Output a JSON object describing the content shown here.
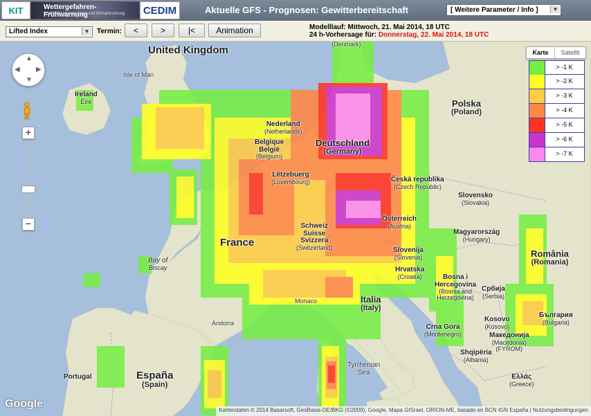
{
  "header": {
    "kit_logo": "KIT",
    "warn_logo_title": "Wettergefahren-Frühwarnung",
    "warn_logo_sub": "Institut für Meteorologie und Klimaforschung",
    "cedim_logo": "CEDIM",
    "title": "Aktuelle GFS - Prognosen: Gewitterbereitschaft",
    "param_select": "[ Weitere Parameter / Info ]"
  },
  "toolbar": {
    "parameter_select": "Lifted Index",
    "termin_label": "Termin:",
    "prev_button": "<",
    "next_button": ">",
    "first_button": "|<",
    "animation_button": "Animation",
    "run_line": "Modelllauf: Mittwoch, 21. Mai 2014, 18 UTC",
    "forecast_prefix": "24 h-Vorhersage für: ",
    "forecast_date": "Donnerstag, 22. Mai 2014, 18 UTC"
  },
  "map_type": {
    "karte": "Karte",
    "satellit": "Satellit"
  },
  "legend": [
    {
      "label": "> -1 K",
      "color": "#77ee44"
    },
    {
      "label": "> -2 K",
      "color": "#ffff22"
    },
    {
      "label": "> -3 K",
      "color": "#ffcc44"
    },
    {
      "label": "> -4 K",
      "color": "#ff8844"
    },
    {
      "label": "> -5 K",
      "color": "#ff3322"
    },
    {
      "label": "> -6 K",
      "color": "#cc33cc"
    },
    {
      "label": "> -7 K",
      "color": "#ff88ee"
    }
  ],
  "labels": {
    "united_kingdom": "United Kingdom",
    "isle_of_man": "Isle of Man",
    "ireland": "Ireland",
    "eire": "Éire",
    "denmark": "(Denmark)",
    "nederland": "Nederland",
    "netherlands": "(Netherlands)",
    "belgique": "Belgique",
    "belgie": "België",
    "belgium": "(Belgium)",
    "deutschland": "Deutschland",
    "germany": "(Germany)",
    "letzebuerg": "Lëtzebuerg",
    "luxembourg": "(Luxembourg)",
    "polska": "Polska",
    "poland": "(Poland)",
    "ceska": "Česká",
    "republika": "republika",
    "czech": "(Czech Republic)",
    "slovensko": "Slovensko",
    "slovakia": "(Slovakia)",
    "osterreich": "Österreich",
    "austria": "(Austria)",
    "magyarorszag": "Magyarország",
    "hungary": "(Hungary)",
    "france": "France",
    "schweiz": "Schweiz",
    "suisse": "Suisse",
    "svizzera": "Svizzera",
    "switzerland": "(Switzerland)",
    "slovenija": "Slovenija",
    "slovenia": "(Slovenia)",
    "romania": "România",
    "romania_en": "(Romania)",
    "bay_of": "Bay of",
    "biscay": "Biscay",
    "hrvatska": "Hrvatska",
    "croatia": "(Croatia)",
    "bosna": "Bosna i",
    "hercegovina": "Hercegovina",
    "bosnia": "(Bosnia and",
    "herzegovina": "Herzegovina)",
    "srbija": "Србија",
    "serbia": "(Serbia)",
    "monaco": "Monaco",
    "andorra": "Andorra",
    "italia": "Italia",
    "italy": "(Italy)",
    "crna_gora": "Crna Gora",
    "montenegro": "(Montenegro)",
    "kosovo": "Kosovo",
    "kosovo_en": "(Kosovo)",
    "bulgaria": "България",
    "bulgaria_en": "(Bulgaria)",
    "makedonija": "Македонија",
    "macedonia": "(Macedonia)",
    "fyrom": "(FYROM)",
    "shqiperia": "Shqipëria",
    "albania": "(Albania)",
    "tyrrhenian": "Tyrrhenian",
    "sea": "Sea",
    "portugal": "Portugal",
    "espana": "España",
    "spain": "(Spain)",
    "ellas": "Ελλάς",
    "greece": "(Greece)"
  },
  "google_logo": "Google",
  "attribution": "Kartendaten © 2014 Basarsoft, GeoBasis-DE/BKG (©2009), Google, Mapa GISrael, ORION-ME, basado en BCN IGN España  |  Nutzungsbedingungen"
}
